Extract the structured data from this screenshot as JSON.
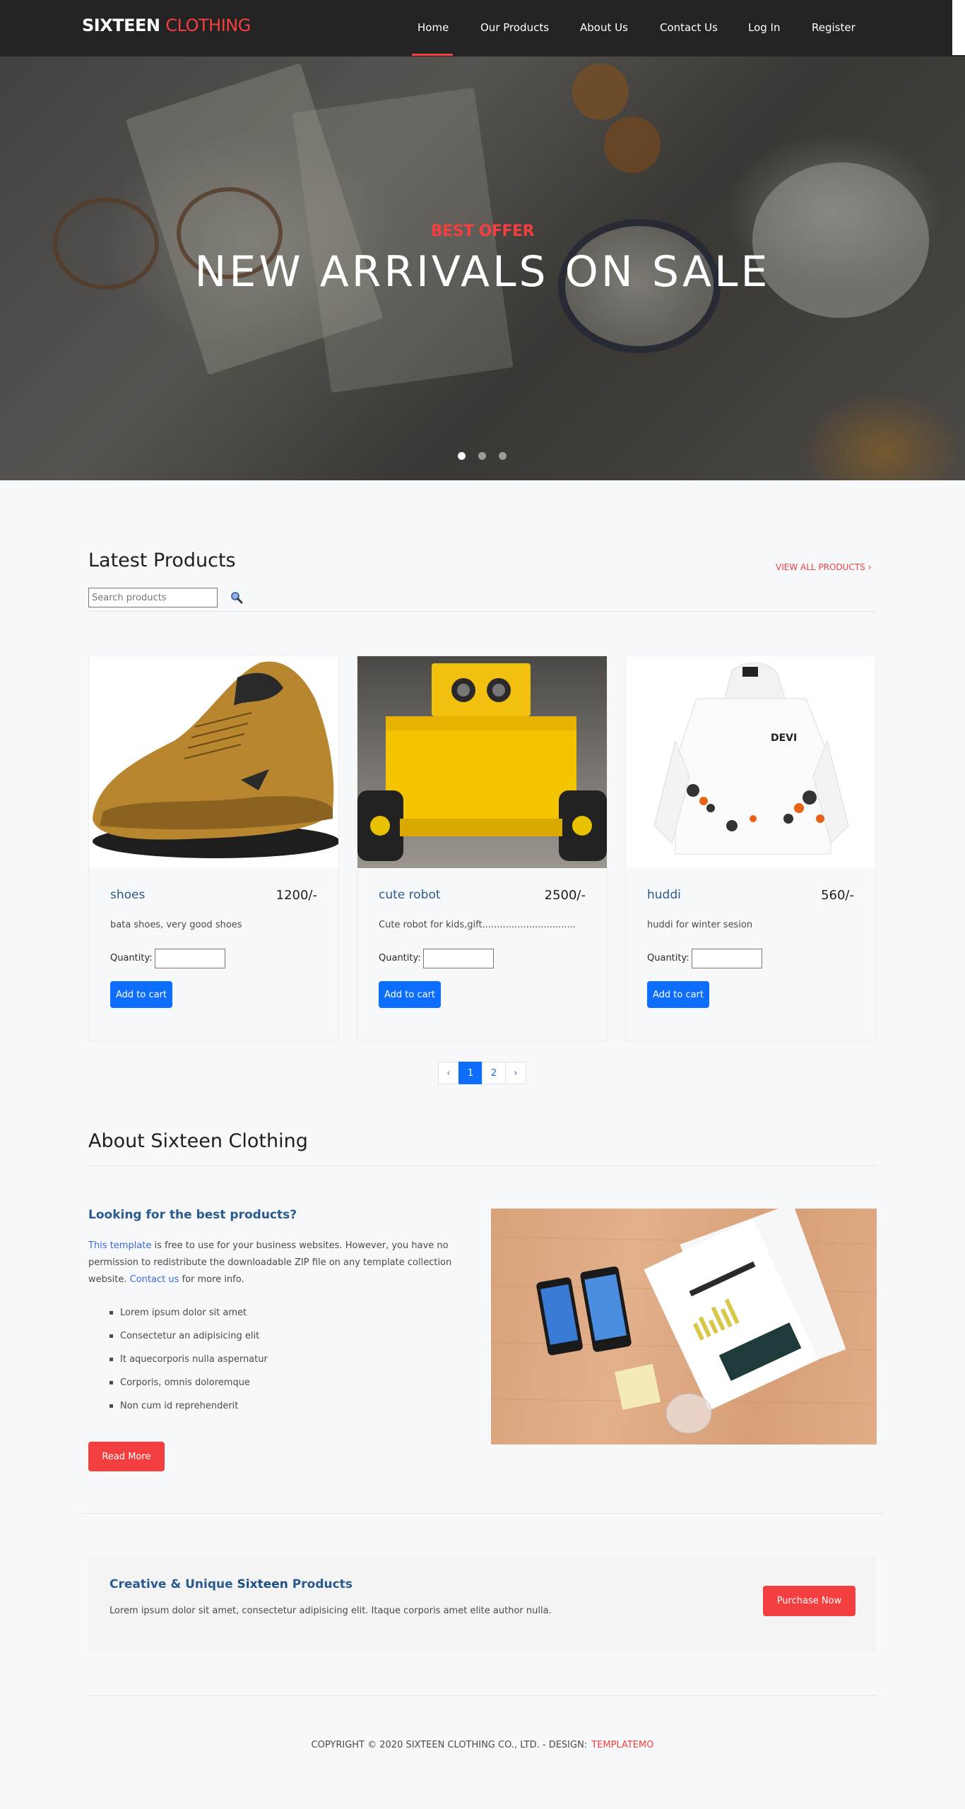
{
  "header": {
    "brand_primary": "SIXTEEN",
    "brand_accent": "CLOTHING",
    "nav": {
      "home": "Home",
      "products": "Our Products",
      "about": "About Us",
      "contact": "Contact Us",
      "login": "Log In",
      "register": "Register"
    }
  },
  "hero": {
    "subtitle": "BEST OFFER",
    "title": "NEW ARRIVALS ON SALE"
  },
  "latest": {
    "title": "Latest Products",
    "view_all": "VIEW ALL PRODUCTS ›",
    "search_placeholder": "Search products",
    "quantity_label": "Quantity:",
    "add_to_cart": "Add to cart",
    "products": [
      {
        "name": "shoes",
        "price": "1200/-",
        "desc": "bata shoes, very good shoes"
      },
      {
        "name": "cute robot",
        "price": "2500/-",
        "desc": "Cute robot for kids,gift................................"
      },
      {
        "name": "huddi",
        "price": "560/-",
        "desc": "huddi for winter sesion"
      }
    ],
    "pagination": {
      "prev": "‹",
      "page1": "1",
      "page2": "2",
      "next": "›",
      "current_page": 1
    }
  },
  "about": {
    "title": "About Sixteen Clothing",
    "subtitle": "Looking for the best products?",
    "link1": "This template",
    "text1": " is free to use for your business websites. However, you have no permission to redistribute the downloadable ZIP file on any template collection website. ",
    "link2": "Contact us",
    "text2": " for more info.",
    "list": [
      "Lorem ipsum dolor sit amet",
      "Consectetur an adipisicing elit",
      "It aquecorporis nulla aspernatur",
      "Corporis, omnis doloremque",
      "Non cum id reprehenderit"
    ],
    "read_more": "Read More"
  },
  "cta": {
    "title_pre": "Creative & Unique ",
    "title_strong": "Sixteen",
    "title_post": " Products",
    "text": "Lorem ipsum dolor sit amet, consectetur adipisicing elit. Itaque corporis amet elite author nulla.",
    "button": "Purchase Now"
  },
  "footer": {
    "copyright": "COPYRIGHT © 2020 SIXTEEN CLOTHING CO., LTD. - DESIGN:",
    "design_link": "TEMPLATEMO"
  },
  "colors": {
    "accent": "#f33f3f",
    "primary_button": "#0d6efd",
    "navbar": "#232323",
    "link_blue": "#2a5a8f"
  }
}
